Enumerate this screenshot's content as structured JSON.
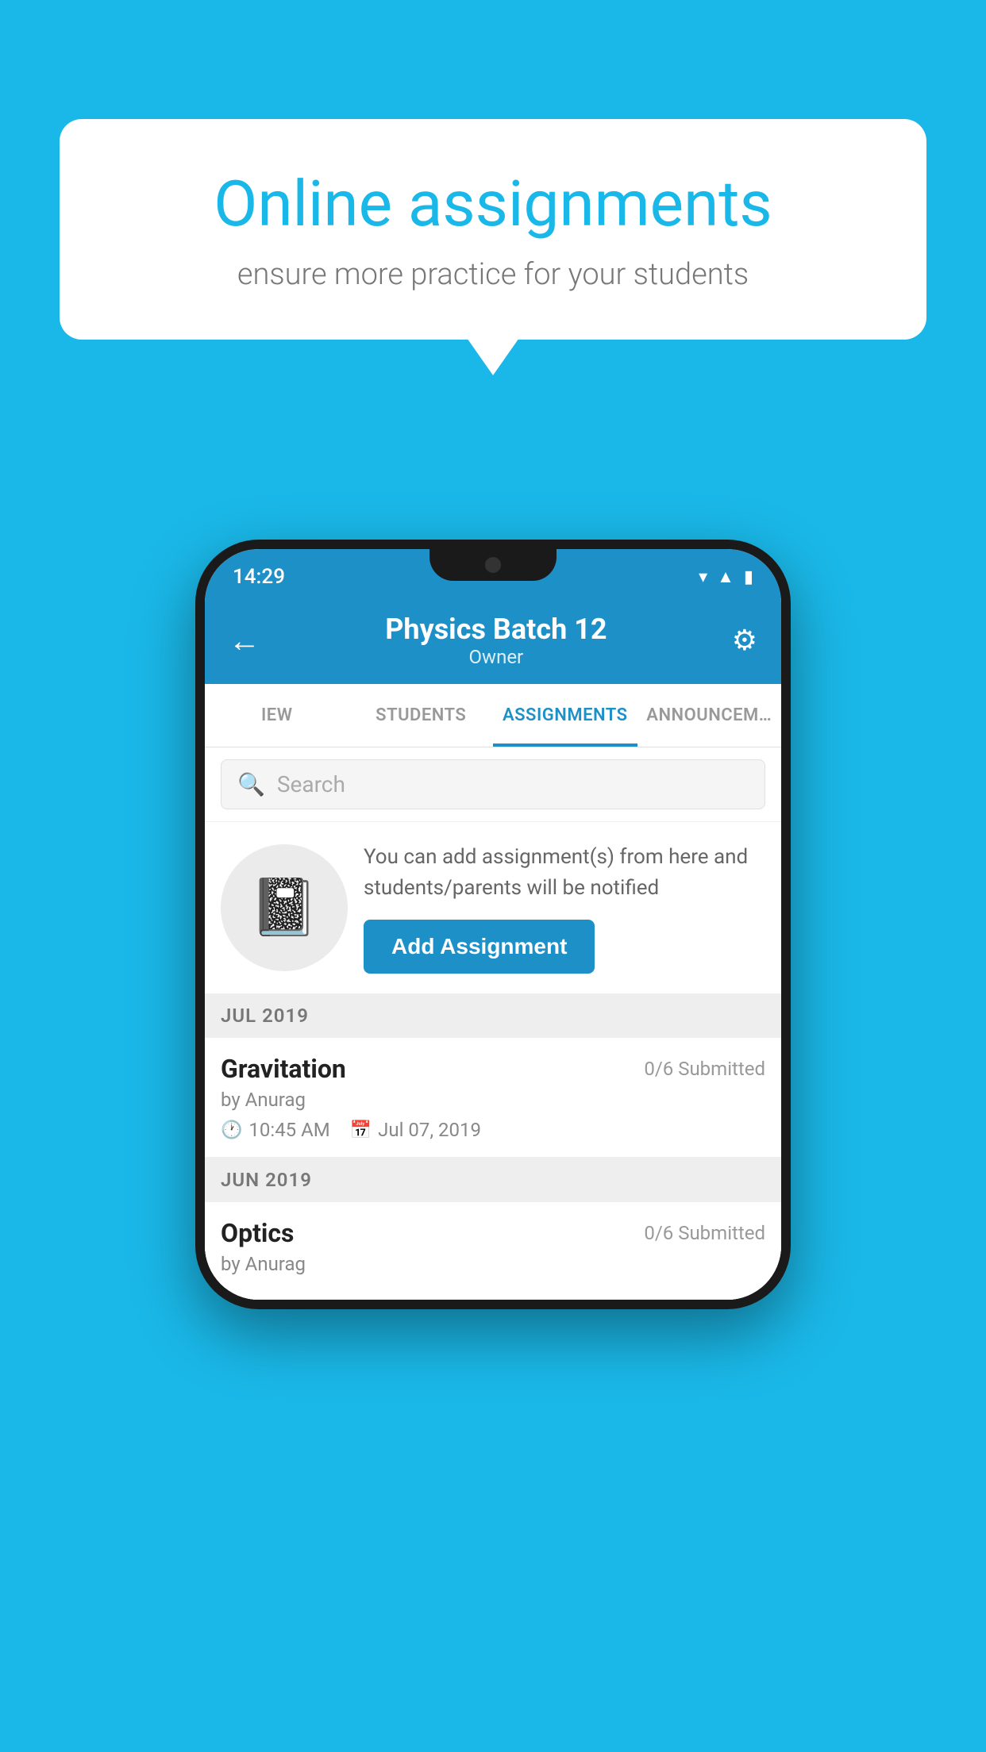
{
  "background_color": "#1ab8e8",
  "speech_bubble": {
    "title": "Online assignments",
    "subtitle": "ensure more practice for your students"
  },
  "phone": {
    "status_bar": {
      "time": "14:29",
      "icons": [
        "wifi",
        "signal",
        "battery"
      ]
    },
    "app_bar": {
      "title": "Physics Batch 12",
      "subtitle": "Owner",
      "back_label": "←",
      "settings_label": "⚙"
    },
    "tabs": [
      {
        "label": "IEW",
        "active": false
      },
      {
        "label": "STUDENTS",
        "active": false
      },
      {
        "label": "ASSIGNMENTS",
        "active": true
      },
      {
        "label": "ANNOUNCEM…",
        "active": false
      }
    ],
    "search": {
      "placeholder": "Search"
    },
    "promo": {
      "description": "You can add assignment(s) from here and students/parents will be notified",
      "button_label": "Add Assignment"
    },
    "sections": [
      {
        "header": "JUL 2019",
        "assignments": [
          {
            "title": "Gravitation",
            "submitted": "0/6 Submitted",
            "author": "by Anurag",
            "time": "10:45 AM",
            "date": "Jul 07, 2019"
          }
        ]
      },
      {
        "header": "JUN 2019",
        "assignments": [
          {
            "title": "Optics",
            "submitted": "0/6 Submitted",
            "author": "by Anurag",
            "time": "",
            "date": ""
          }
        ]
      }
    ]
  }
}
